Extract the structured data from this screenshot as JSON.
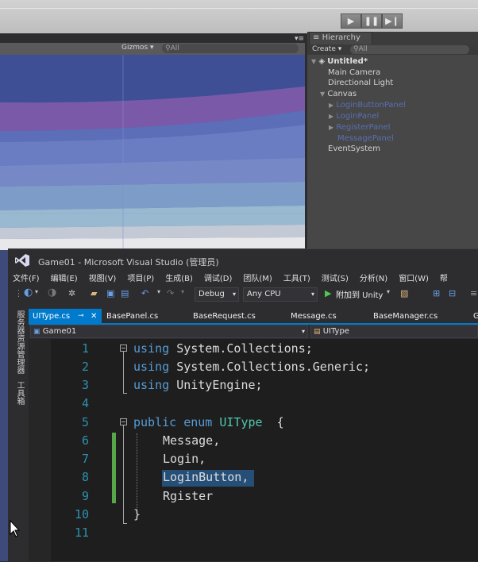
{
  "unity": {
    "play_controls": [
      "play-icon",
      "pause-icon",
      "step-icon"
    ],
    "scene": {
      "gizmos_label": "Gizmos",
      "search_placeholder": "All"
    },
    "hierarchy": {
      "tab_label": "Hierarchy",
      "create_label": "Create",
      "search_placeholder": "All",
      "scene_name": "Untitled*",
      "items": [
        {
          "label": "Main Camera",
          "indent": 1,
          "state": "normal"
        },
        {
          "label": "Directional Light",
          "indent": 1,
          "state": "normal"
        },
        {
          "label": "Canvas",
          "indent": 1,
          "state": "normal",
          "expanded": true
        },
        {
          "label": "LoginButtonPanel",
          "indent": 2,
          "state": "inactive",
          "has_children": true
        },
        {
          "label": "LoginPanel",
          "indent": 2,
          "state": "inactive",
          "has_children": true
        },
        {
          "label": "RegisterPanel",
          "indent": 2,
          "state": "inactive",
          "has_children": true
        },
        {
          "label": "MessagePanel",
          "indent": 2,
          "state": "inactive"
        },
        {
          "label": "EventSystem",
          "indent": 1,
          "state": "normal"
        }
      ]
    }
  },
  "vs": {
    "title": "Game01 - Microsoft Visual Studio (管理员)",
    "menu": [
      "文件(F)",
      "编辑(E)",
      "视图(V)",
      "项目(P)",
      "生成(B)",
      "调试(D)",
      "团队(M)",
      "工具(T)",
      "测试(S)",
      "分析(N)",
      "窗口(W)",
      "帮"
    ],
    "toolbar": {
      "config": "Debug",
      "platform": "Any CPU",
      "attach_label": "附加到 Unity"
    },
    "side_panels": [
      "服务器资源管理器",
      "工具箱"
    ],
    "tabs": [
      {
        "label": "UIType.cs",
        "active": true
      },
      {
        "label": "BasePanel.cs",
        "active": false
      },
      {
        "label": "BaseRequest.cs",
        "active": false
      },
      {
        "label": "Message.cs",
        "active": false
      },
      {
        "label": "BaseManager.cs",
        "active": false
      },
      {
        "label": "G",
        "active": false
      }
    ],
    "nav": {
      "project": "Game01",
      "member": "UIType"
    },
    "code_lines": [
      {
        "n": "1",
        "text": "using System.Collections;"
      },
      {
        "n": "2",
        "text": "using System.Collections.Generic;"
      },
      {
        "n": "3",
        "text": "using UnityEngine;"
      },
      {
        "n": "4",
        "text": ""
      },
      {
        "n": "5",
        "text": "public enum UIType  {"
      },
      {
        "n": "6",
        "text": "Message,"
      },
      {
        "n": "7",
        "text": "Login,"
      },
      {
        "n": "8",
        "text": "LoginButton,"
      },
      {
        "n": "9",
        "text": "Rgister"
      },
      {
        "n": "10",
        "text": "}"
      },
      {
        "n": "11",
        "text": ""
      }
    ],
    "code": {
      "kw_using": "using",
      "ns1": "System.Collections;",
      "ns2": "System.Collections.Generic;",
      "ns3": "UnityEngine;",
      "kw_public": "public",
      "kw_enum": "enum",
      "type_name": "UIType",
      "open_brace": "{",
      "member1": "Message,",
      "member2": "Login,",
      "member3": "LoginButton,",
      "member4": "Rgister",
      "close_brace": "}"
    },
    "colors": {
      "accent": "#007acc",
      "keyword": "#569cd6",
      "type": "#4ec9b0",
      "line_number": "#2b91af",
      "selection": "#264f78",
      "change_bar": "#57a64a"
    }
  }
}
